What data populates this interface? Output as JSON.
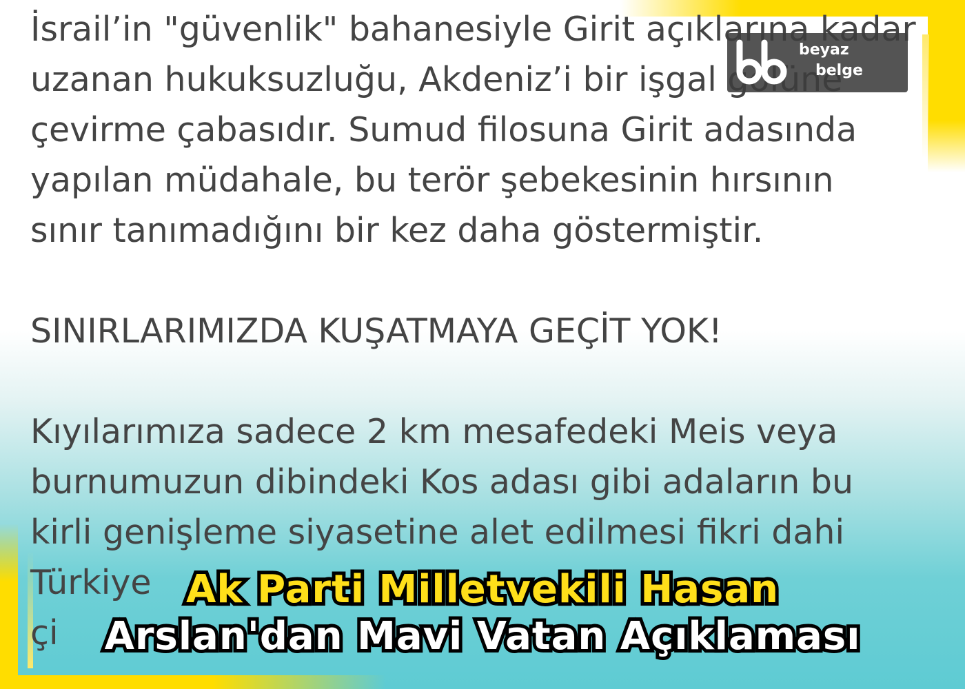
{
  "post": {
    "paragraph1": [
      "İsrail’in \"güvenlik\" bahanesiyle Girit açıklarına kadar",
      "uzanan hukuksuzluğu, Akdeniz’i bir işgal gölüne",
      "çevirme çabasıdır. Sumud filosuna Girit adasında",
      "yapılan müdahale, bu terör şebekesinin hırsının",
      "sınır tanımadığını bir kez daha göstermiştir."
    ],
    "heading": "SINIRLARIMIZDA KUŞATMAYA GEÇİT YOK!",
    "paragraph2": [
      "Kıyılarımıza sadece 2 km mesafedeki Meis veya",
      "burnumuzun dibindeki Kos adası gibi adaların bu",
      "kirli genişleme siyasetine alet edilmesi fikri dahi",
      "Türkiye",
      "çi"
    ]
  },
  "logo": {
    "icon": "bb-logo-icon",
    "word1": "beyaz",
    "word2": "belge"
  },
  "headline": {
    "line1": "Ak Parti Milletvekili Hasan",
    "line2": "Arslan'dan Mavi Vatan Açıklaması"
  },
  "colors": {
    "frame_yellow": "#ffdd00",
    "headline_yellow": "#ffdf1a",
    "text_gray": "#444444",
    "bottom_teal": "#5ecbd3"
  }
}
